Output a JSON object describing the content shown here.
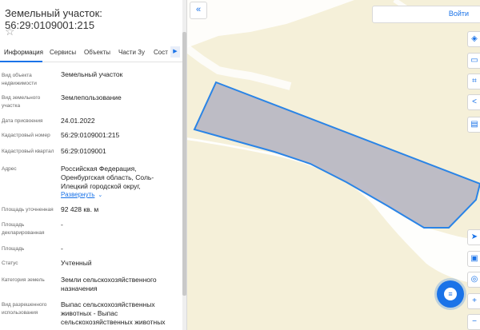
{
  "parcel": {
    "title": "Земельный участок: 56:29:0109001:215"
  },
  "header": {
    "star_icon": "star-outline-icon",
    "collapse_icon": "chevrons-left-icon",
    "login_label": "Войти"
  },
  "tabs": [
    {
      "label": "Информация",
      "active": true
    },
    {
      "label": "Сервисы"
    },
    {
      "label": "Объекты"
    },
    {
      "label": "Части Зу"
    },
    {
      "label": "Сост"
    }
  ],
  "fields": [
    {
      "label": "Вид объекта недвижимости",
      "value": "Земельный участок"
    },
    {
      "label": "Вид земельного участка",
      "value": "Землепользование"
    },
    {
      "label": "Дата присвоения",
      "value": "24.01.2022"
    },
    {
      "label": "Кадастровый номер",
      "value": "56:29:0109001:215"
    },
    {
      "label": "Кадастровый квартал",
      "value": "56:29:0109001"
    },
    {
      "label": "Адрес",
      "value": "Российская Федерация, Оренбургская область, Соль-Илецкий городской округ,",
      "expand": "Развернуть"
    },
    {
      "label": "Площадь уточненная",
      "value": "92 428 кв. м"
    },
    {
      "label": "Площадь декларированная",
      "value": "-"
    },
    {
      "label": "Площадь",
      "value": "-"
    },
    {
      "label": "Статус",
      "value": "Учтенный"
    },
    {
      "label": "Категория земель",
      "value": "Земли сельскохозяйственного назначения"
    },
    {
      "label": "Вид разрешенного использования",
      "value": "Выпас сельскохозяйственных животных - Выпас сельскохозяйственных животных"
    }
  ],
  "map_tools": [
    "layers-icon",
    "ruler-icon",
    "qr-scan-icon",
    "share-icon",
    "print-icon"
  ],
  "map_tools_bottom": [
    "navigate-icon",
    "screen-icon",
    "locate-icon",
    "zoom-in-icon",
    "zoom-out-icon"
  ],
  "colors": {
    "accent": "#1a73e8",
    "map_background": "#f5f0d9",
    "parcel_fill": "#b9b8c4",
    "parcel_stroke": "#2a84e6"
  }
}
